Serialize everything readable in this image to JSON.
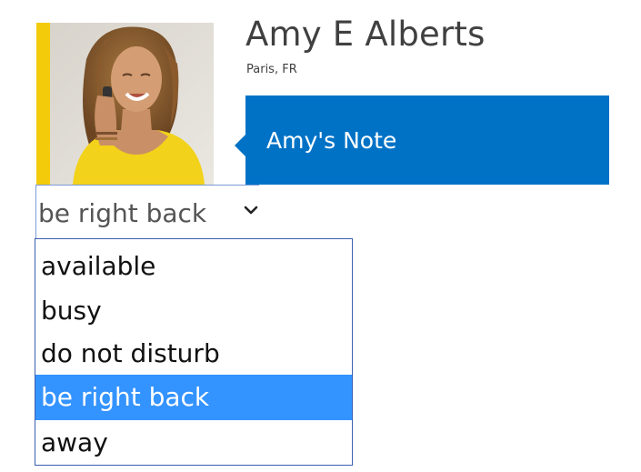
{
  "contact": {
    "name": "Amy E Alberts",
    "location": "Paris, FR",
    "note": "Amy's Note",
    "presence_color": "#f4cb0a"
  },
  "status": {
    "selected": "be right back",
    "options": [
      {
        "label": "available"
      },
      {
        "label": "busy"
      },
      {
        "label": "do not disturb"
      },
      {
        "label": "be right back",
        "selected": true
      },
      {
        "label": "away"
      }
    ]
  },
  "colors": {
    "accent": "#0072c6",
    "highlight": "#3393ff",
    "presence_away": "#f4cb0a"
  },
  "icons": {
    "dropdown": "chevron-down-icon"
  }
}
